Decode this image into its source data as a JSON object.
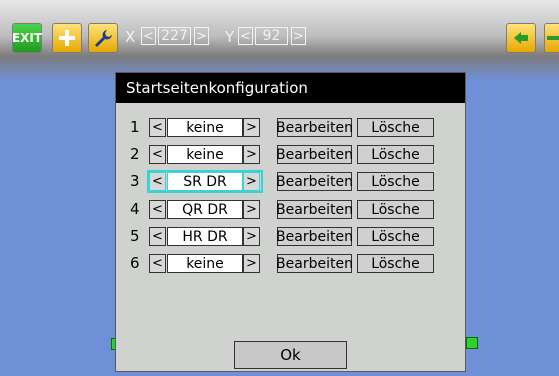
{
  "toolbar": {
    "exit_label": "EXIT",
    "x_label": "X",
    "x_value": "227",
    "y_label": "Y",
    "y_value": "92",
    "left_arrow": "<",
    "right_arrow": ">",
    "icons": [
      "add-icon",
      "wrench-icon",
      "arrow-left-icon",
      "arrow-right-icon"
    ]
  },
  "dialog": {
    "title": "Startseitenkonfiguration",
    "rows": [
      {
        "num": "1",
        "value": "keine",
        "edit": "Bearbeiten",
        "delete": "Lösche"
      },
      {
        "num": "2",
        "value": "keine",
        "edit": "Bearbeiten",
        "delete": "Lösche"
      },
      {
        "num": "3",
        "value": "SR DR",
        "edit": "Bearbeiten",
        "delete": "Lösche",
        "focused": true
      },
      {
        "num": "4",
        "value": "QR DR",
        "edit": "Bearbeiten",
        "delete": "Lösche"
      },
      {
        "num": "5",
        "value": "HR DR",
        "edit": "Bearbeiten",
        "delete": "Lösche"
      },
      {
        "num": "6",
        "value": "keine",
        "edit": "Bearbeiten",
        "delete": "Lösche"
      }
    ],
    "arrow_left": "<",
    "arrow_right": ">",
    "ok_label": "Ok"
  },
  "colors": {
    "background": "#6f8fd6",
    "focus": "#39d3d3",
    "title_bar": "#000000",
    "dialog_bg": "#cfd2cf"
  }
}
